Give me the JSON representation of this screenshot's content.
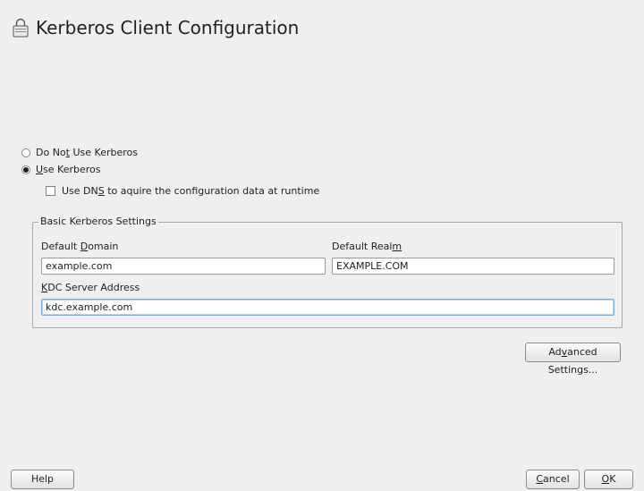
{
  "title": "Kerberos Client Configuration",
  "radio_options": [
    {
      "pre": "Do No",
      "mnemonic": "t",
      "post": " Use Kerberos",
      "selected": false
    },
    {
      "pre": "",
      "mnemonic": "U",
      "post": "se Kerberos",
      "selected": true
    }
  ],
  "dns_checkbox": {
    "pre": "Use DN",
    "mnemonic": "S",
    "post": " to aquire the configuration data at runtime",
    "checked": false
  },
  "basic_settings": {
    "legend": "Basic Kerberos Settings",
    "default_domain": {
      "pre": "Default ",
      "mnemonic": "D",
      "post": "omain",
      "value": "example.com"
    },
    "default_realm": {
      "pre": "Default Real",
      "mnemonic": "m",
      "post": "",
      "value": "EXAMPLE.COM"
    },
    "kdc_server": {
      "pre": "",
      "mnemonic": "K",
      "post": "DC Server Address",
      "value": "kdc.example.com"
    }
  },
  "advanced_button": {
    "pre": "Ad",
    "mnemonic": "v",
    "post": "anced Settings..."
  },
  "footer": {
    "help": "Help",
    "cancel": {
      "pre": "",
      "mnemonic": "C",
      "post": "ancel"
    },
    "ok": {
      "pre": "",
      "mnemonic": "O",
      "post": "K"
    }
  }
}
